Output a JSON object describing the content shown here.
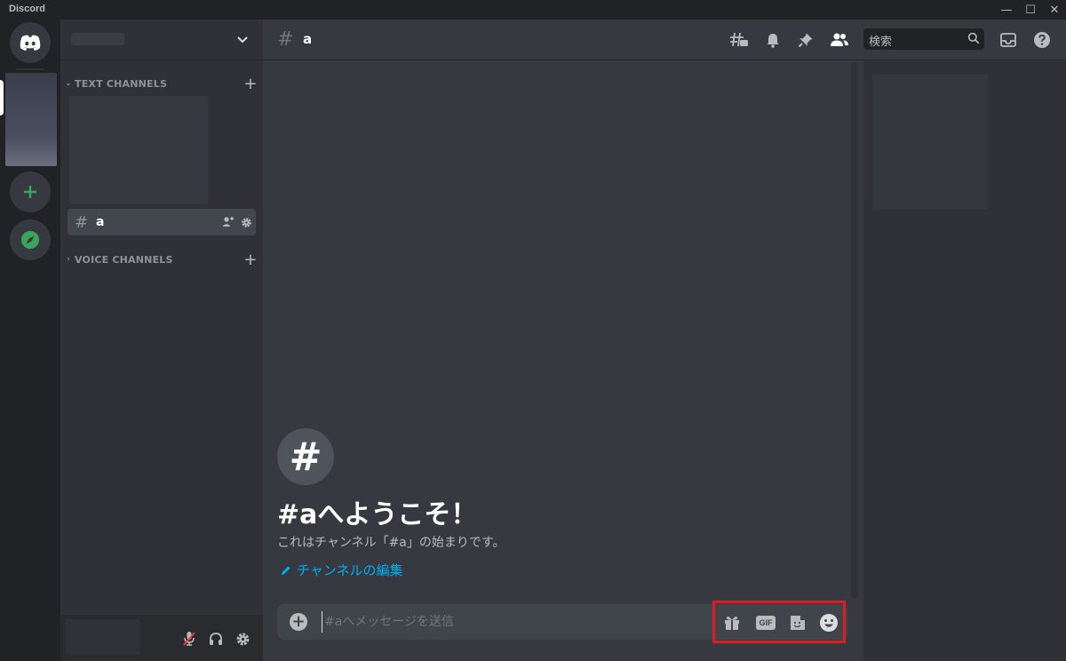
{
  "app": {
    "title": "Discord"
  },
  "window_controls": {
    "minimize": "—",
    "maximize": "☐",
    "close": "✕"
  },
  "sidebar": {
    "categories": [
      {
        "label": "TEXT CHANNELS",
        "arrow": "⌄"
      },
      {
        "label": "VOICE CHANNELS",
        "arrow": "›"
      }
    ],
    "channel": {
      "hash": "#",
      "name": "a"
    },
    "plus_glyph": "+"
  },
  "header": {
    "hash": "#",
    "channel_name": "a",
    "search_placeholder": "検索"
  },
  "welcome": {
    "icon_glyph": "#",
    "title": "#aへようこそ！",
    "subtitle": "これはチャンネル「#a」の始まりです。",
    "edit_link": "チャンネルの編集"
  },
  "composer": {
    "placeholder": "#aへメッセージを送信",
    "plus_glyph": "+",
    "gif_label": "GIF"
  },
  "colors": {
    "accent_green": "#3ba55c",
    "link": "#00b0f4",
    "highlight_box": "#e01b24",
    "muted_red": "#ed4245"
  }
}
